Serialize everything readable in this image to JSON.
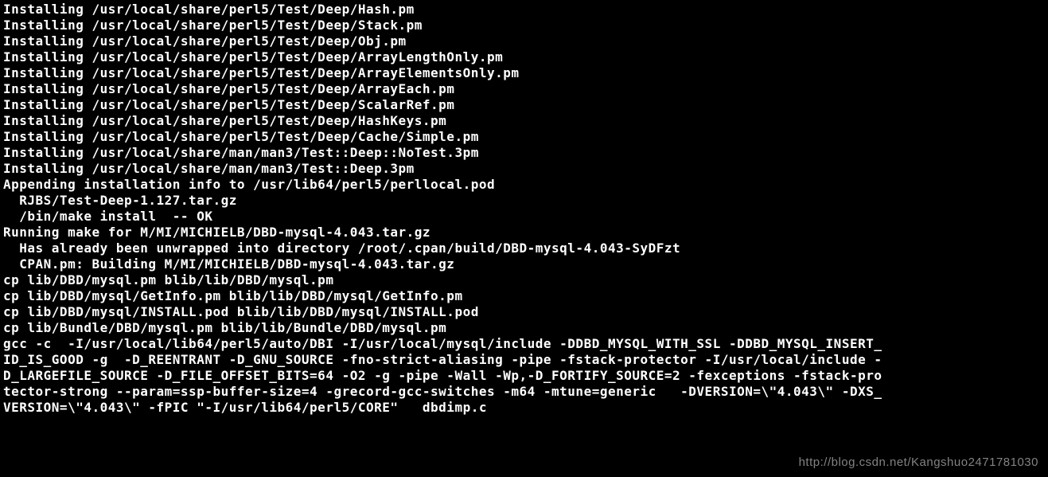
{
  "terminal": {
    "lines": [
      "Installing /usr/local/share/perl5/Test/Deep/Hash.pm",
      "Installing /usr/local/share/perl5/Test/Deep/Stack.pm",
      "Installing /usr/local/share/perl5/Test/Deep/Obj.pm",
      "Installing /usr/local/share/perl5/Test/Deep/ArrayLengthOnly.pm",
      "Installing /usr/local/share/perl5/Test/Deep/ArrayElementsOnly.pm",
      "Installing /usr/local/share/perl5/Test/Deep/ArrayEach.pm",
      "Installing /usr/local/share/perl5/Test/Deep/ScalarRef.pm",
      "Installing /usr/local/share/perl5/Test/Deep/HashKeys.pm",
      "Installing /usr/local/share/perl5/Test/Deep/Cache/Simple.pm",
      "Installing /usr/local/share/man/man3/Test::Deep::NoTest.3pm",
      "Installing /usr/local/share/man/man3/Test::Deep.3pm",
      "Appending installation info to /usr/lib64/perl5/perllocal.pod",
      "  RJBS/Test-Deep-1.127.tar.gz",
      "  /bin/make install  -- OK",
      "Running make for M/MI/MICHIELB/DBD-mysql-4.043.tar.gz",
      "  Has already been unwrapped into directory /root/.cpan/build/DBD-mysql-4.043-SyDFzt",
      "",
      "  CPAN.pm: Building M/MI/MICHIELB/DBD-mysql-4.043.tar.gz",
      "",
      "cp lib/DBD/mysql.pm blib/lib/DBD/mysql.pm",
      "cp lib/DBD/mysql/GetInfo.pm blib/lib/DBD/mysql/GetInfo.pm",
      "cp lib/DBD/mysql/INSTALL.pod blib/lib/DBD/mysql/INSTALL.pod",
      "cp lib/Bundle/DBD/mysql.pm blib/lib/Bundle/DBD/mysql.pm",
      "gcc -c  -I/usr/local/lib64/perl5/auto/DBI -I/usr/local/mysql/include -DDBD_MYSQL_WITH_SSL -DDBD_MYSQL_INSERT_",
      "ID_IS_GOOD -g  -D_REENTRANT -D_GNU_SOURCE -fno-strict-aliasing -pipe -fstack-protector -I/usr/local/include -",
      "D_LARGEFILE_SOURCE -D_FILE_OFFSET_BITS=64 -O2 -g -pipe -Wall -Wp,-D_FORTIFY_SOURCE=2 -fexceptions -fstack-pro",
      "tector-strong --param=ssp-buffer-size=4 -grecord-gcc-switches -m64 -mtune=generic   -DVERSION=\\\"4.043\\\" -DXS_",
      "VERSION=\\\"4.043\\\" -fPIC \"-I/usr/lib64/perl5/CORE\"   dbdimp.c"
    ]
  },
  "watermark": "http://blog.csdn.net/Kangshuo2471781030"
}
